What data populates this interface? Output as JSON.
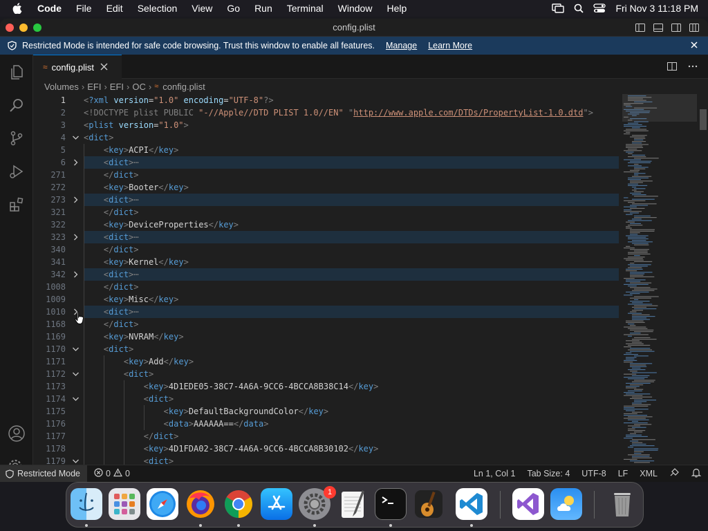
{
  "menubar": {
    "app_name": "Code",
    "items": [
      "File",
      "Edit",
      "Selection",
      "View",
      "Go",
      "Run",
      "Terminal",
      "Window",
      "Help"
    ],
    "clock": "Fri Nov 3  11:18 PM"
  },
  "window": {
    "title": "config.plist"
  },
  "banner": {
    "message": "Restricted Mode is intended for safe code browsing. Trust this window to enable all features.",
    "manage": "Manage",
    "learn_more": "Learn More"
  },
  "tab": {
    "label": "config.plist"
  },
  "breadcrumb": {
    "parts": [
      "Volumes",
      "EFI",
      "EFI",
      "OC",
      "config.plist"
    ]
  },
  "editor": {
    "lines": [
      {
        "n": "1",
        "fold": "",
        "indent": 0,
        "hl": false,
        "cur": true,
        "segs": [
          [
            "tg",
            "<"
          ],
          [
            "tn",
            "?xml "
          ],
          [
            "at",
            "version"
          ],
          [
            "tx",
            "="
          ],
          [
            "sv",
            "\"1.0\""
          ],
          [
            "tx",
            " "
          ],
          [
            "at",
            "encoding"
          ],
          [
            "tx",
            "="
          ],
          [
            "sv",
            "\"UTF-8\""
          ],
          [
            "tg",
            "?>"
          ]
        ]
      },
      {
        "n": "2",
        "fold": "",
        "indent": 0,
        "hl": false,
        "segs": [
          [
            "tg",
            "<!DOCTYPE plist PUBLIC "
          ],
          [
            "sv",
            "\"-//Apple//DTD PLIST 1.0//EN\""
          ],
          [
            "tg",
            " \""
          ],
          [
            "url",
            "http://www.apple.com/DTDs/PropertyList-1.0.dtd"
          ],
          [
            "tg",
            "\">"
          ]
        ]
      },
      {
        "n": "3",
        "fold": "",
        "indent": 0,
        "hl": false,
        "segs": [
          [
            "tg",
            "<"
          ],
          [
            "tn",
            "plist "
          ],
          [
            "at",
            "version"
          ],
          [
            "tx",
            "="
          ],
          [
            "sv",
            "\"1.0\""
          ],
          [
            "tg",
            ">"
          ]
        ]
      },
      {
        "n": "4",
        "fold": "down",
        "indent": 0,
        "hl": false,
        "segs": [
          [
            "tg",
            "<"
          ],
          [
            "tn",
            "dict"
          ],
          [
            "tg",
            ">"
          ]
        ]
      },
      {
        "n": "5",
        "fold": "",
        "indent": 1,
        "hl": false,
        "segs": [
          [
            "tg",
            "<"
          ],
          [
            "tn",
            "key"
          ],
          [
            "tg",
            ">"
          ],
          [
            "tx",
            "ACPI"
          ],
          [
            "tg",
            "</"
          ],
          [
            "tn",
            "key"
          ],
          [
            "tg",
            ">"
          ]
        ]
      },
      {
        "n": "6",
        "fold": "right",
        "indent": 1,
        "hl": true,
        "segs": [
          [
            "tg",
            "<"
          ],
          [
            "tn",
            "dict"
          ],
          [
            "tg",
            ">"
          ],
          [
            "tg",
            "⋯"
          ]
        ]
      },
      {
        "n": "271",
        "fold": "",
        "indent": 1,
        "hl": false,
        "segs": [
          [
            "tg",
            "</"
          ],
          [
            "tn",
            "dict"
          ],
          [
            "tg",
            ">"
          ]
        ]
      },
      {
        "n": "272",
        "fold": "",
        "indent": 1,
        "hl": false,
        "segs": [
          [
            "tg",
            "<"
          ],
          [
            "tn",
            "key"
          ],
          [
            "tg",
            ">"
          ],
          [
            "tx",
            "Booter"
          ],
          [
            "tg",
            "</"
          ],
          [
            "tn",
            "key"
          ],
          [
            "tg",
            ">"
          ]
        ]
      },
      {
        "n": "273",
        "fold": "right",
        "indent": 1,
        "hl": true,
        "segs": [
          [
            "tg",
            "<"
          ],
          [
            "tn",
            "dict"
          ],
          [
            "tg",
            ">"
          ],
          [
            "tg",
            "⋯"
          ]
        ]
      },
      {
        "n": "321",
        "fold": "",
        "indent": 1,
        "hl": false,
        "segs": [
          [
            "tg",
            "</"
          ],
          [
            "tn",
            "dict"
          ],
          [
            "tg",
            ">"
          ]
        ]
      },
      {
        "n": "322",
        "fold": "",
        "indent": 1,
        "hl": false,
        "segs": [
          [
            "tg",
            "<"
          ],
          [
            "tn",
            "key"
          ],
          [
            "tg",
            ">"
          ],
          [
            "tx",
            "DeviceProperties"
          ],
          [
            "tg",
            "</"
          ],
          [
            "tn",
            "key"
          ],
          [
            "tg",
            ">"
          ]
        ]
      },
      {
        "n": "323",
        "fold": "right",
        "indent": 1,
        "hl": true,
        "segs": [
          [
            "tg",
            "<"
          ],
          [
            "tn",
            "dict"
          ],
          [
            "tg",
            ">"
          ],
          [
            "tg",
            "⋯"
          ]
        ]
      },
      {
        "n": "340",
        "fold": "",
        "indent": 1,
        "hl": false,
        "segs": [
          [
            "tg",
            "</"
          ],
          [
            "tn",
            "dict"
          ],
          [
            "tg",
            ">"
          ]
        ]
      },
      {
        "n": "341",
        "fold": "",
        "indent": 1,
        "hl": false,
        "segs": [
          [
            "tg",
            "<"
          ],
          [
            "tn",
            "key"
          ],
          [
            "tg",
            ">"
          ],
          [
            "tx",
            "Kernel"
          ],
          [
            "tg",
            "</"
          ],
          [
            "tn",
            "key"
          ],
          [
            "tg",
            ">"
          ]
        ]
      },
      {
        "n": "342",
        "fold": "right",
        "indent": 1,
        "hl": true,
        "segs": [
          [
            "tg",
            "<"
          ],
          [
            "tn",
            "dict"
          ],
          [
            "tg",
            ">"
          ],
          [
            "tg",
            "⋯"
          ]
        ]
      },
      {
        "n": "1008",
        "fold": "",
        "indent": 1,
        "hl": false,
        "segs": [
          [
            "tg",
            "</"
          ],
          [
            "tn",
            "dict"
          ],
          [
            "tg",
            ">"
          ]
        ]
      },
      {
        "n": "1009",
        "fold": "",
        "indent": 1,
        "hl": false,
        "segs": [
          [
            "tg",
            "<"
          ],
          [
            "tn",
            "key"
          ],
          [
            "tg",
            ">"
          ],
          [
            "tx",
            "Misc"
          ],
          [
            "tg",
            "</"
          ],
          [
            "tn",
            "key"
          ],
          [
            "tg",
            ">"
          ]
        ]
      },
      {
        "n": "1010",
        "fold": "right",
        "indent": 1,
        "hl": true,
        "segs": [
          [
            "tg",
            "<"
          ],
          [
            "tn",
            "dict"
          ],
          [
            "tg",
            ">"
          ],
          [
            "tg",
            "⋯"
          ]
        ]
      },
      {
        "n": "1168",
        "fold": "",
        "indent": 1,
        "hl": false,
        "segs": [
          [
            "tg",
            "</"
          ],
          [
            "tn",
            "dict"
          ],
          [
            "tg",
            ">"
          ]
        ]
      },
      {
        "n": "1169",
        "fold": "",
        "indent": 1,
        "hl": false,
        "segs": [
          [
            "tg",
            "<"
          ],
          [
            "tn",
            "key"
          ],
          [
            "tg",
            ">"
          ],
          [
            "tx",
            "NVRAM"
          ],
          [
            "tg",
            "</"
          ],
          [
            "tn",
            "key"
          ],
          [
            "tg",
            ">"
          ]
        ]
      },
      {
        "n": "1170",
        "fold": "down",
        "indent": 1,
        "hl": false,
        "segs": [
          [
            "tg",
            "<"
          ],
          [
            "tn",
            "dict"
          ],
          [
            "tg",
            ">"
          ]
        ]
      },
      {
        "n": "1171",
        "fold": "",
        "indent": 2,
        "hl": false,
        "segs": [
          [
            "tg",
            "<"
          ],
          [
            "tn",
            "key"
          ],
          [
            "tg",
            ">"
          ],
          [
            "tx",
            "Add"
          ],
          [
            "tg",
            "</"
          ],
          [
            "tn",
            "key"
          ],
          [
            "tg",
            ">"
          ]
        ]
      },
      {
        "n": "1172",
        "fold": "down",
        "indent": 2,
        "hl": false,
        "segs": [
          [
            "tg",
            "<"
          ],
          [
            "tn",
            "dict"
          ],
          [
            "tg",
            ">"
          ]
        ]
      },
      {
        "n": "1173",
        "fold": "",
        "indent": 3,
        "hl": false,
        "segs": [
          [
            "tg",
            "<"
          ],
          [
            "tn",
            "key"
          ],
          [
            "tg",
            ">"
          ],
          [
            "tx",
            "4D1EDE05-38C7-4A6A-9CC6-4BCCA8B38C14"
          ],
          [
            "tg",
            "</"
          ],
          [
            "tn",
            "key"
          ],
          [
            "tg",
            ">"
          ]
        ]
      },
      {
        "n": "1174",
        "fold": "down",
        "indent": 3,
        "hl": false,
        "segs": [
          [
            "tg",
            "<"
          ],
          [
            "tn",
            "dict"
          ],
          [
            "tg",
            ">"
          ]
        ]
      },
      {
        "n": "1175",
        "fold": "",
        "indent": 4,
        "hl": false,
        "segs": [
          [
            "tg",
            "<"
          ],
          [
            "tn",
            "key"
          ],
          [
            "tg",
            ">"
          ],
          [
            "tx",
            "DefaultBackgroundColor"
          ],
          [
            "tg",
            "</"
          ],
          [
            "tn",
            "key"
          ],
          [
            "tg",
            ">"
          ]
        ]
      },
      {
        "n": "1176",
        "fold": "",
        "indent": 4,
        "hl": false,
        "segs": [
          [
            "tg",
            "<"
          ],
          [
            "tn",
            "data"
          ],
          [
            "tg",
            ">"
          ],
          [
            "tx",
            "AAAAAA=="
          ],
          [
            "tg",
            "</"
          ],
          [
            "tn",
            "data"
          ],
          [
            "tg",
            ">"
          ]
        ]
      },
      {
        "n": "1177",
        "fold": "",
        "indent": 3,
        "hl": false,
        "segs": [
          [
            "tg",
            "</"
          ],
          [
            "tn",
            "dict"
          ],
          [
            "tg",
            ">"
          ]
        ]
      },
      {
        "n": "1178",
        "fold": "",
        "indent": 3,
        "hl": false,
        "segs": [
          [
            "tg",
            "<"
          ],
          [
            "tn",
            "key"
          ],
          [
            "tg",
            ">"
          ],
          [
            "tx",
            "4D1FDA02-38C7-4A6A-9CC6-4BCCA8B30102"
          ],
          [
            "tg",
            "</"
          ],
          [
            "tn",
            "key"
          ],
          [
            "tg",
            ">"
          ]
        ]
      },
      {
        "n": "1179",
        "fold": "down",
        "indent": 3,
        "hl": false,
        "segs": [
          [
            "tg",
            "<"
          ],
          [
            "tn",
            "dict"
          ],
          [
            "tg",
            ">"
          ]
        ]
      }
    ]
  },
  "statusbar": {
    "restricted": "Restricted Mode",
    "errors": "0",
    "warnings": "0",
    "position": "Ln 1, Col 1",
    "tab_size": "Tab Size: 4",
    "encoding": "UTF-8",
    "eol": "LF",
    "language": "XML"
  },
  "dock": {
    "badge": "1",
    "apps": [
      "finder-icon",
      "launchpad-icon",
      "safari-icon",
      "firefox-icon",
      "chrome-icon",
      "app-store-icon",
      "system-settings-icon",
      "textedit-icon",
      "terminal-icon",
      "garageband-icon",
      "vscode-icon",
      "visual-studio-icon",
      "weather-icon",
      "trash-icon"
    ]
  },
  "colors": {
    "accent": "#0078d4",
    "banner": "#1b3a5c",
    "editor_bg": "#1f1f1f",
    "tag": "#569cd6",
    "attr": "#9cdcfe",
    "string": "#ce9178"
  }
}
